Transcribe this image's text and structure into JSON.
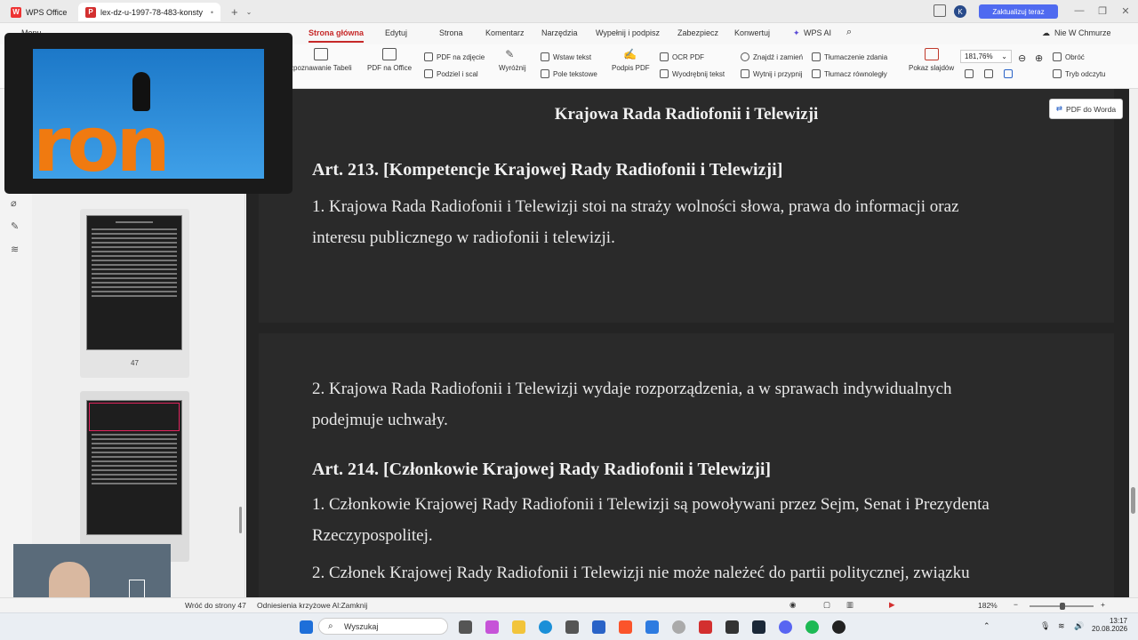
{
  "titlebar": {
    "app_tab": "WPS Office",
    "doc_tab": "lex-dz-u-1997-78-483-konsty",
    "new_tab": "+",
    "upgrade_label": "Zaktualizuj teraz",
    "avatar_letter": "K"
  },
  "menu": {
    "items": [
      "Menu",
      "Strona główna",
      "Edytuj",
      "Strona",
      "Komentarz",
      "Narzędzia",
      "Wypełnij i podpisz",
      "Zabezpiecz",
      "Konwertuj",
      "WPS AI"
    ],
    "cloud": "Nie W Chmurze"
  },
  "ribbon": {
    "table_recognition": "zpoznawanie Tabeli",
    "pdf_to_office": "PDF na Office",
    "pdf_to_image": "PDF na zdjęcie",
    "split_merge": "Podziel i scal",
    "highlight": "Wyróżnij",
    "insert_text": "Wstaw tekst",
    "text_fields": "Pole tekstowe",
    "sign_pdf": "Podpis PDF",
    "ocr_pdf": "OCR PDF",
    "extract_text": "Wyodrębnij tekst",
    "find_replace": "Znajdź i zamień",
    "cut_paste": "Wytnij i przypnij",
    "translate_sentence": "Tłumaczenie zdania",
    "parallel_translate": "Tłumacz równoległy",
    "slideshow": "Pokaz slajdów",
    "zoom": "181,76%",
    "rotate": "Obróć",
    "read_mode": "Tryb odczytu"
  },
  "thumbnails": {
    "page_number": "47"
  },
  "document": {
    "header_center": "Krajowa Rada Radiofonii i Telewizji",
    "art213_title": "Art. 213. [Kompetencje Krajowej Rady Radiofonii i Telewizji]",
    "art213_p1_line1": "1.  Krajowa Rada Radiofonii i Telewizji stoi na straży wolności słowa, prawa do informacji oraz",
    "art213_p1_line2": "interesu publicznego w radiofonii i telewizji.",
    "art213_p2_line1": "2.  Krajowa Rada Radiofonii i Telewizji wydaje rozporządzenia, a w sprawach indywidualnych",
    "art213_p2_line2": "podejmuje uchwały.",
    "art214_title": "Art. 214. [Członkowie Krajowej Rady Radiofonii i Telewizji]",
    "art214_p1_line1": "1.  Członkowie Krajowej Rady Radiofonii i Telewizji są powoływani przez Sejm, Senat i Prezydenta",
    "art214_p1_line2": "Rzeczypospolitej.",
    "art214_p2_line1": "2.  Członek Krajowej Rady Radiofonii i Telewizji nie może należeć do partii politycznej, związku",
    "pdf_to_word": "PDF do Worda"
  },
  "video_overlay": {
    "text": "ron"
  },
  "statusbar": {
    "back_to_page": "Wróć do strony 47",
    "cross_refs": "Odniesienia krzyżowe Al:Zamknij",
    "zoom": "182%"
  },
  "taskbar": {
    "search_placeholder": "Wyszukaj",
    "time": "13:17",
    "date": "20.08.2026"
  },
  "colors": {
    "accent_red": "#c62828",
    "upgrade_blue": "#4f6af0",
    "doc_bg": "#242424"
  }
}
